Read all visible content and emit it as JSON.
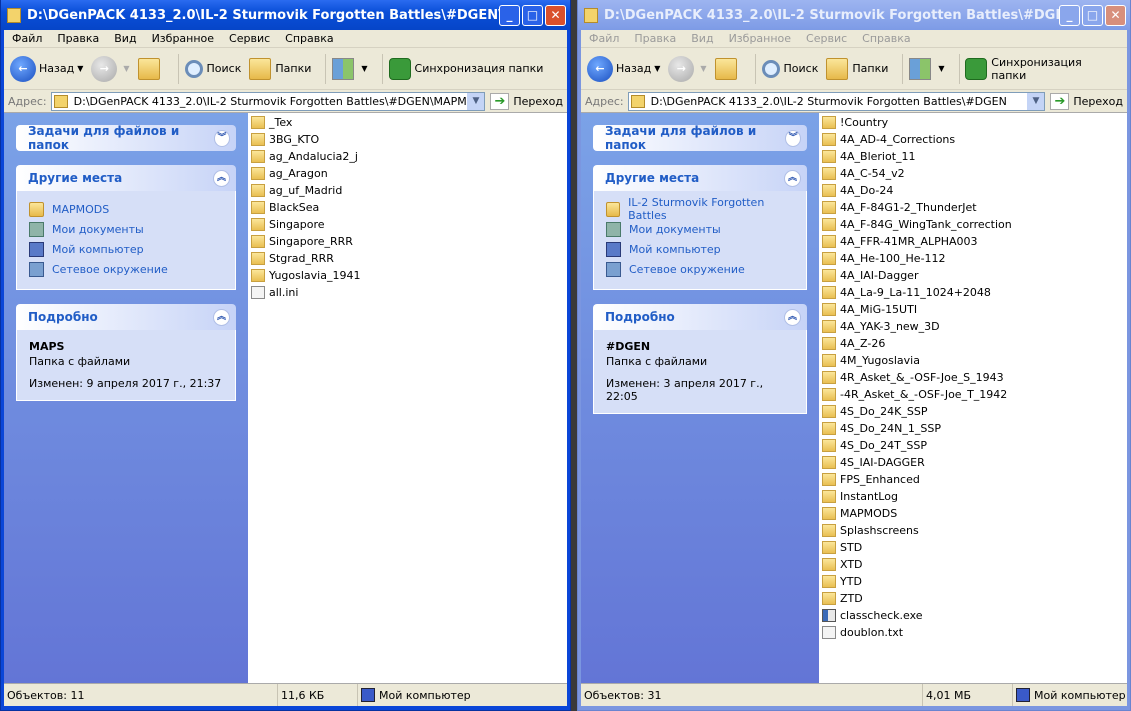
{
  "windows": [
    {
      "title": "D:\\DGenPACK 4133_2.0\\IL-2 Sturmovik Forgotten Battles\\#DGEN\\MAPMO...",
      "active": true,
      "menu": [
        "Файл",
        "Правка",
        "Вид",
        "Избранное",
        "Сервис",
        "Справка"
      ],
      "toolbar": {
        "back": "Назад",
        "search": "Поиск",
        "folders": "Папки",
        "sync": "Синхронизация папки"
      },
      "address": {
        "label": "Адрес:",
        "value": "D:\\DGenPACK 4133_2.0\\IL-2 Sturmovik Forgotten Battles\\#DGEN\\MAPMODS\\MAP",
        "go": "Переход"
      },
      "tasks_title": "Задачи для файлов и папок",
      "places_title": "Другие места",
      "places": [
        {
          "label": "MAPMODS",
          "icon": "folder-icon"
        },
        {
          "label": "Мои документы",
          "icon": "my-documents-icon"
        },
        {
          "label": "Мой компьютер",
          "icon": "my-computer-icon"
        },
        {
          "label": "Сетевое окружение",
          "icon": "network-icon"
        }
      ],
      "details_title": "Подробно",
      "details": {
        "name": "MAPS",
        "type": "Папка с файлами",
        "modified": "Изменен: 9 апреля 2017 г., 21:37"
      },
      "files": [
        {
          "name": "_Tex",
          "type": "folder"
        },
        {
          "name": "3BG_KTO",
          "type": "folder"
        },
        {
          "name": "ag_Andalucia2_j",
          "type": "folder"
        },
        {
          "name": "ag_Aragon",
          "type": "folder"
        },
        {
          "name": "ag_uf_Madrid",
          "type": "folder"
        },
        {
          "name": "BlackSea",
          "type": "folder"
        },
        {
          "name": "Singapore",
          "type": "folder"
        },
        {
          "name": "Singapore_RRR",
          "type": "folder"
        },
        {
          "name": "Stgrad_RRR",
          "type": "folder"
        },
        {
          "name": "Yugoslavia_1941",
          "type": "folder"
        },
        {
          "name": "all.ini",
          "type": "file"
        }
      ],
      "status": {
        "objects": "Объектов: 11",
        "size": "11,6 КБ",
        "location": "Мой компьютер"
      }
    },
    {
      "title": "D:\\DGenPACK 4133_2.0\\IL-2 Sturmovik Forgotten Battles\\#DGEN",
      "active": false,
      "menu": [
        "Файл",
        "Правка",
        "Вид",
        "Избранное",
        "Сервис",
        "Справка"
      ],
      "toolbar": {
        "back": "Назад",
        "search": "Поиск",
        "folders": "Папки",
        "sync": "Синхронизация папки"
      },
      "address": {
        "label": "Адрес:",
        "value": "D:\\DGenPACK 4133_2.0\\IL-2 Sturmovik Forgotten Battles\\#DGEN",
        "go": "Переход"
      },
      "tasks_title": "Задачи для файлов и папок",
      "places_title": "Другие места",
      "places": [
        {
          "label": "IL-2 Sturmovik Forgotten Battles",
          "icon": "folder-icon"
        },
        {
          "label": "Мои документы",
          "icon": "my-documents-icon"
        },
        {
          "label": "Мой компьютер",
          "icon": "my-computer-icon"
        },
        {
          "label": "Сетевое окружение",
          "icon": "network-icon"
        }
      ],
      "details_title": "Подробно",
      "details": {
        "name": "#DGEN",
        "type": "Папка с файлами",
        "modified": "Изменен: 3 апреля 2017 г., 22:05"
      },
      "files": [
        {
          "name": "!Country",
          "type": "folder"
        },
        {
          "name": "4A_AD-4_Corrections",
          "type": "folder"
        },
        {
          "name": "4A_Bleriot_11",
          "type": "folder"
        },
        {
          "name": "4A_C-54_v2",
          "type": "folder"
        },
        {
          "name": "4A_Do-24",
          "type": "folder"
        },
        {
          "name": "4A_F-84G1-2_ThunderJet",
          "type": "folder"
        },
        {
          "name": "4A_F-84G_WingTank_correction",
          "type": "folder"
        },
        {
          "name": "4A_FFR-41MR_ALPHA003",
          "type": "folder"
        },
        {
          "name": "4A_He-100_He-112",
          "type": "folder"
        },
        {
          "name": "4A_IAI-Dagger",
          "type": "folder"
        },
        {
          "name": "4A_La-9_La-11_1024+2048",
          "type": "folder"
        },
        {
          "name": "4A_MiG-15UTI",
          "type": "folder"
        },
        {
          "name": "4A_YAK-3_new_3D",
          "type": "folder"
        },
        {
          "name": "4A_Z-26",
          "type": "folder"
        },
        {
          "name": "4M_Yugoslavia",
          "type": "folder"
        },
        {
          "name": "4R_Asket_&_-OSF-Joe_S_1943",
          "type": "folder"
        },
        {
          "name": "-4R_Asket_&_-OSF-Joe_T_1942",
          "type": "folder"
        },
        {
          "name": "4S_Do_24K_SSP",
          "type": "folder"
        },
        {
          "name": "4S_Do_24N_1_SSP",
          "type": "folder"
        },
        {
          "name": "4S_Do_24T_SSP",
          "type": "folder"
        },
        {
          "name": "4S_IAI-DAGGER",
          "type": "folder"
        },
        {
          "name": "FPS_Enhanced",
          "type": "folder"
        },
        {
          "name": "InstantLog",
          "type": "folder"
        },
        {
          "name": "MAPMODS",
          "type": "folder"
        },
        {
          "name": "Splashscreens",
          "type": "folder"
        },
        {
          "name": "STD",
          "type": "folder"
        },
        {
          "name": "XTD",
          "type": "folder"
        },
        {
          "name": "YTD",
          "type": "folder"
        },
        {
          "name": "ZTD",
          "type": "folder"
        },
        {
          "name": "classcheck.exe",
          "type": "exe"
        },
        {
          "name": "doublon.txt",
          "type": "file"
        }
      ],
      "status": {
        "objects": "Объектов: 31",
        "size": "4,01 МБ",
        "location": "Мой компьютер"
      }
    }
  ]
}
